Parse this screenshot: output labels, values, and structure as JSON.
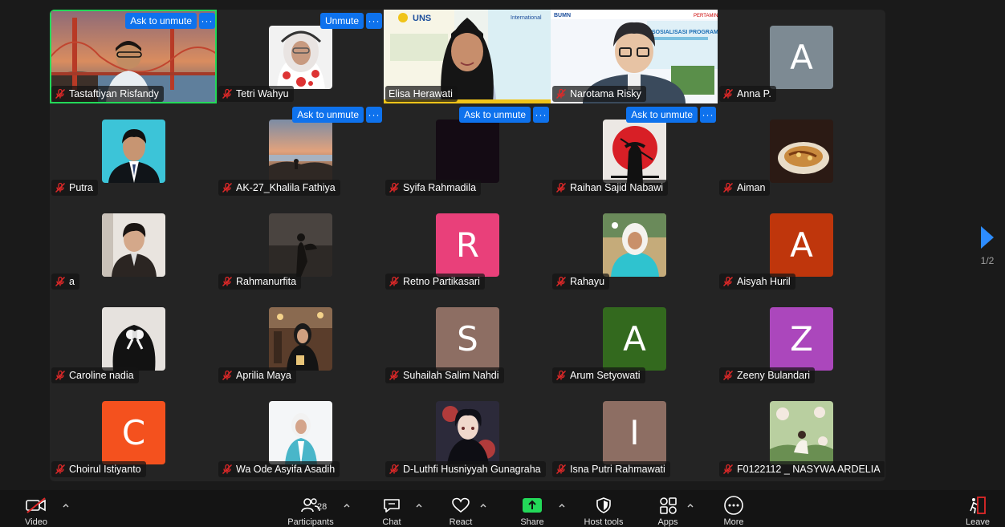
{
  "gallery": {
    "page_indicator": "1/2",
    "participants": [
      {
        "name": "Tastaftiyan Risfandy",
        "kind": "video",
        "scene": "golden-gate",
        "talking": true,
        "button": "Ask to unmute",
        "muted": true
      },
      {
        "name": "Tetri Wahyu",
        "kind": "photo",
        "scene": "hijab-flowers",
        "button": "Unmute",
        "muted": true
      },
      {
        "name": "Elisa Herawati",
        "kind": "video",
        "scene": "uns-speaker",
        "muted": false
      },
      {
        "name": "Narotama Risky",
        "kind": "video",
        "scene": "pertamina-avatar",
        "muted": true
      },
      {
        "name": "Anna P.",
        "kind": "letter",
        "letter": "A",
        "color": "#7d8a93",
        "muted": true
      },
      {
        "name": "Putra",
        "kind": "photo",
        "scene": "formal-cyan",
        "muted": true
      },
      {
        "name": "AK-27_Khalila Fathiya",
        "kind": "photo",
        "scene": "sunset-rocks",
        "button": "Ask to unmute",
        "muted": true
      },
      {
        "name": "Syifa Rahmadila",
        "kind": "photo",
        "scene": "dark",
        "button": "Ask to unmute",
        "muted": true
      },
      {
        "name": "Raihan Sajid Nabawi",
        "kind": "photo",
        "scene": "samurai-sun",
        "button": "Ask to unmute",
        "muted": true
      },
      {
        "name": "Aiman",
        "kind": "photo",
        "scene": "food",
        "muted": true
      },
      {
        "name": "a",
        "kind": "photo",
        "scene": "portrait-dark",
        "muted": true
      },
      {
        "name": "Rahmanurfita",
        "kind": "photo",
        "scene": "silhouette",
        "muted": true
      },
      {
        "name": "Retno Partikasari",
        "kind": "letter",
        "letter": "R",
        "color": "#e9407a",
        "muted": true
      },
      {
        "name": "Rahayu",
        "kind": "photo",
        "scene": "hijab-teal",
        "muted": true
      },
      {
        "name": "Aisyah Huril",
        "kind": "letter",
        "letter": "A",
        "color": "#bf360c",
        "muted": true
      },
      {
        "name": "Caroline nadia",
        "kind": "photo",
        "scene": "hair-bow",
        "muted": true
      },
      {
        "name": "Aprilia Maya",
        "kind": "photo",
        "scene": "cafe",
        "muted": true
      },
      {
        "name": "Suhailah Salim Nahdi",
        "kind": "letter",
        "letter": "S",
        "color": "#8d6e63",
        "muted": true
      },
      {
        "name": "Arum Setyowati",
        "kind": "letter",
        "letter": "A",
        "color": "#33691e",
        "muted": true
      },
      {
        "name": "Zeeny Bulandari",
        "kind": "letter",
        "letter": "Z",
        "color": "#ab47bc",
        "muted": true
      },
      {
        "name": "Choirul Istiyanto",
        "kind": "letter",
        "letter": "C",
        "color": "#f4511e",
        "muted": true
      },
      {
        "name": "Wa Ode Asyifa Asadih",
        "kind": "photo",
        "scene": "hijab-white",
        "muted": true
      },
      {
        "name": "D-Luthfi Husniyyah Gunagraha",
        "kind": "photo",
        "scene": "anime",
        "muted": true
      },
      {
        "name": "Isna Putri Rahmawati",
        "kind": "letter",
        "letter": "I",
        "color": "#8d6e63",
        "muted": true
      },
      {
        "name": "F0122112 _ NASYWA ARDELIA",
        "kind": "photo",
        "scene": "illustration",
        "muted": true
      }
    ]
  },
  "toolbar": {
    "video_label": "Video",
    "participants_label": "Participants",
    "participants_count": "28",
    "chat_label": "Chat",
    "react_label": "React",
    "share_label": "Share",
    "host_tools_label": "Host tools",
    "apps_label": "Apps",
    "more_label": "More",
    "leave_label": "Leave",
    "share_color": "#23d959",
    "leave_color": "#e02828"
  }
}
